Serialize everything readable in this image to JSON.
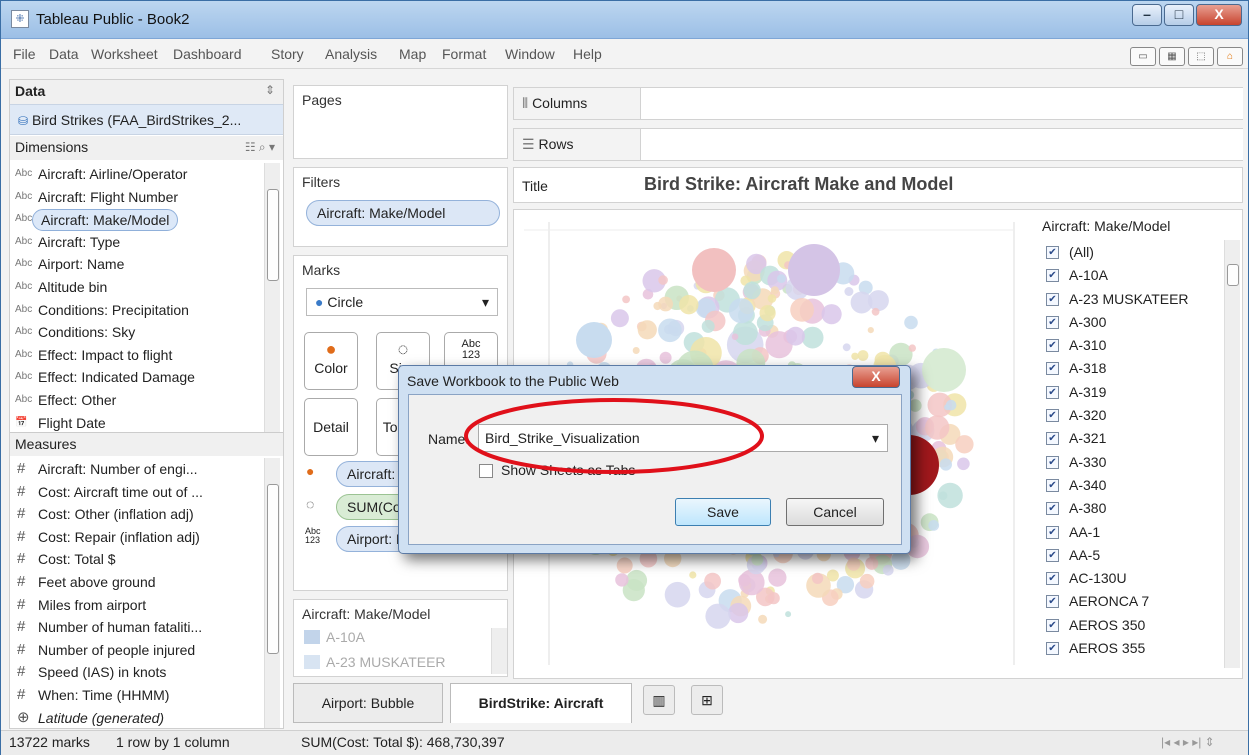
{
  "window": {
    "title": "Tableau Public - Book2",
    "app_icon_glyph": "⁜",
    "minimize": "–",
    "maximize": "□",
    "close": "X"
  },
  "menu": [
    "File",
    "Data",
    "Worksheet",
    "Dashboard",
    "Story",
    "Analysis",
    "Map",
    "Format",
    "Window",
    "Help"
  ],
  "data_pane": {
    "header": "Data",
    "source": "Bird Strikes (FAA_BirdStrikes_2...",
    "dimensions_label": "Dimensions",
    "dimensions": [
      {
        "type": "Abc",
        "name": "Aircraft: Airline/Operator"
      },
      {
        "type": "Abc",
        "name": "Aircraft: Flight Number"
      },
      {
        "type": "Abc",
        "name": "Aircraft: Make/Model",
        "selected": true
      },
      {
        "type": "Abc",
        "name": "Aircraft: Type"
      },
      {
        "type": "Abc",
        "name": "Airport: Name"
      },
      {
        "type": "Abc",
        "name": "Altitude bin"
      },
      {
        "type": "Abc",
        "name": "Conditions: Precipitation"
      },
      {
        "type": "Abc",
        "name": "Conditions: Sky"
      },
      {
        "type": "Abc",
        "name": "Effect: Impact to flight"
      },
      {
        "type": "Abc",
        "name": "Effect: Indicated Damage"
      },
      {
        "type": "Abc",
        "name": "Effect: Other"
      },
      {
        "type": "📅",
        "name": "Flight Date"
      }
    ],
    "measures_label": "Measures",
    "measures": [
      "Aircraft: Number of engi...",
      "Cost: Aircraft time out of ...",
      "Cost: Other (inflation adj)",
      "Cost: Repair (inflation adj)",
      "Cost: Total $",
      "Feet above ground",
      "Miles from airport",
      "Number of human fataliti...",
      "Number of people injured",
      "Speed (IAS) in knots",
      "When: Time (HHMM)",
      "Latitude (generated)"
    ]
  },
  "shelves": {
    "pages": "Pages",
    "filters": "Filters",
    "filter_pill": "Aircraft: Make/Model",
    "marks": "Marks",
    "mark_type": "Circle",
    "color": "Color",
    "size": "Size",
    "label_icon": "Abc\n123",
    "detail": "Detail",
    "tooltip": "Tooltip",
    "mark_pills": [
      "Aircraft: Make/Model",
      "SUM(Cost: Total $)",
      "Airport: Name"
    ],
    "columns": "Columns",
    "rows": "Rows",
    "title_label": "Title",
    "title_value": "Bird Strike: Aircraft Make and Model"
  },
  "color_legend": {
    "title": "Aircraft: Make/Model",
    "items": [
      "A-10A",
      "A-23 MUSKATEER"
    ]
  },
  "filter_card": {
    "title": "Aircraft: Make/Model",
    "items": [
      "(All)",
      "A-10A",
      "A-23 MUSKATEER",
      "A-300",
      "A-310",
      "A-318",
      "A-319",
      "A-320",
      "A-321",
      "A-330",
      "A-340",
      "A-380",
      "AA-1",
      "AA-5",
      "AC-130U",
      "AERONCA 7",
      "AEROS 350",
      "AEROS 355"
    ]
  },
  "tabs": [
    "Airport: Bubble",
    "BirdStrike: Aircraft"
  ],
  "status": {
    "marks": "13722 marks",
    "layout": "1 row by 1 column",
    "sum": "SUM(Cost: Total $): 468,730,397"
  },
  "dialog": {
    "title": "Save Workbook to the Public Web",
    "name_label": "Name:",
    "name_value": "Bird_Strike_Visualization",
    "checkbox_label": "Show Sheets as Tabs",
    "save": "Save",
    "cancel": "Cancel"
  },
  "colors": {
    "accent": "#dce7f6",
    "annotation": "#e0101a"
  }
}
